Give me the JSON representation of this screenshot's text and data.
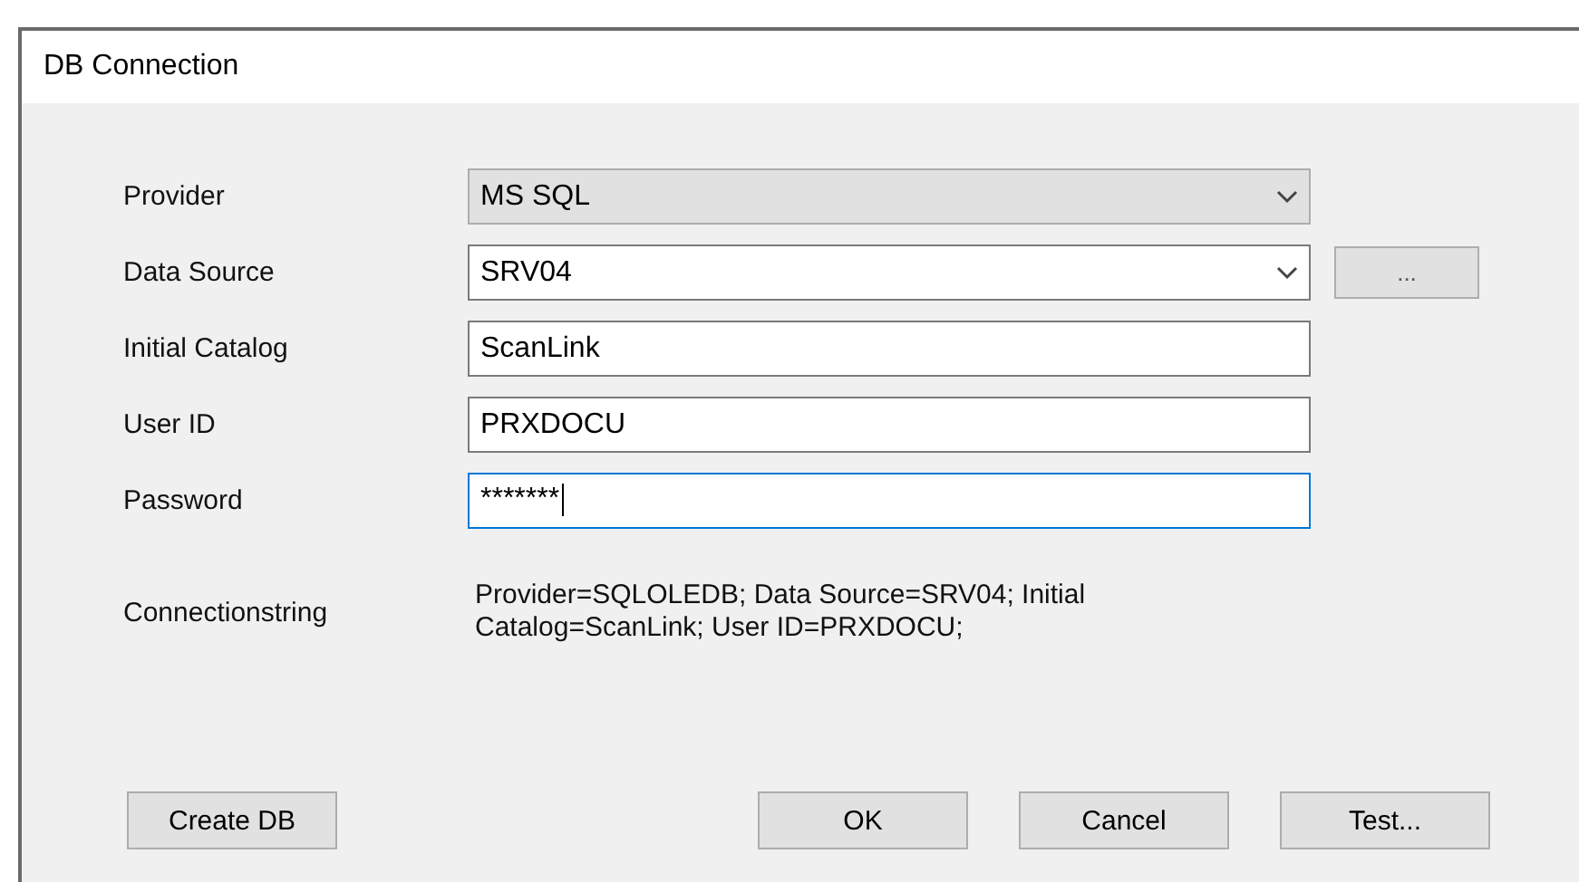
{
  "window": {
    "title": "DB Connection"
  },
  "fields": [
    {
      "label": "Provider",
      "kind": "dropdown",
      "value": "MS SQL",
      "focused": false
    },
    {
      "label": "Data Source",
      "kind": "combo",
      "value": "SRV04",
      "focused": false,
      "browse_button": "..."
    },
    {
      "label": "Initial Catalog",
      "kind": "text",
      "value": "ScanLink",
      "focused": false
    },
    {
      "label": "User ID",
      "kind": "text",
      "value": "PRXDOCU",
      "focused": false
    },
    {
      "label": "Password",
      "kind": "password",
      "value": "*******",
      "focused": true
    }
  ],
  "connection_string": {
    "label": "Connectionstring",
    "value": "Provider=SQLOLEDB; Data Source=SRV04; Initial Catalog=ScanLink; User ID=PRXDOCU;"
  },
  "buttons": {
    "left": [
      "Create DB"
    ],
    "right": [
      "OK",
      "Cancel",
      "Test..."
    ]
  }
}
